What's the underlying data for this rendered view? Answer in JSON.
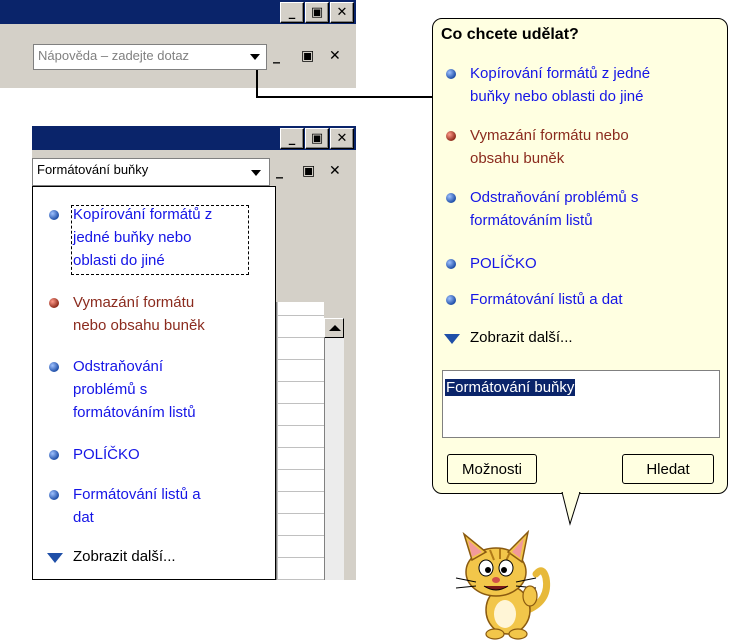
{
  "top_window": {
    "buttons": [
      "_",
      "▣",
      "✕"
    ],
    "help_placeholder": "Nápověda – zadejte dotaz",
    "controls": [
      "_",
      "▣",
      "✕"
    ]
  },
  "inner_window": {
    "buttons": [
      "_",
      "▣",
      "✕"
    ],
    "combo_value": "Formátování buňky",
    "controls": [
      "_",
      "▣",
      "✕"
    ]
  },
  "dropdown": {
    "items": [
      {
        "text": "Kopírování formátů z jedné buňky nebo oblasti do jiné",
        "lines": [
          "Kopírování formátů z",
          "jedné buňky nebo",
          "oblasti do jiné"
        ],
        "color": "#1515e6"
      },
      {
        "text": "Vymazání formátu nebo obsahu buněk",
        "lines": [
          "Vymazání formátu",
          "nebo obsahu buněk"
        ],
        "color": "#8b2b1e"
      },
      {
        "text": "Odstraňování problémů s formátováním listů",
        "lines": [
          "Odstraňování",
          "problémů s",
          "formátováním listů"
        ],
        "color": "#1515e6"
      },
      {
        "text": "POLÍČKO",
        "lines": [
          "POLÍČKO"
        ],
        "color": "#1515e6"
      },
      {
        "text": "Formátování listů a dat",
        "lines": [
          "Formátování listů a",
          "dat"
        ],
        "color": "#1515e6"
      }
    ],
    "more": "Zobrazit další..."
  },
  "balloon": {
    "title": "Co chcete udělat?",
    "items": [
      {
        "lines": [
          "Kopírování formátů z jedné",
          "buňky nebo oblasti do jiné"
        ],
        "color": "#1515e6"
      },
      {
        "lines": [
          "Vymazání formátu nebo",
          "obsahu buněk"
        ],
        "color": "#8b2b1e"
      },
      {
        "lines": [
          "Odstraňování problémů s",
          "formátováním listů"
        ],
        "color": "#1515e6"
      },
      {
        "lines": [
          "POLÍČKO"
        ],
        "color": "#1515e6"
      },
      {
        "lines": [
          "Formátování listů a dat"
        ],
        "color": "#1515e6"
      }
    ],
    "more": "Zobrazit další...",
    "input_value": "Formátování buňky",
    "options_button": "Možnosti",
    "search_button": "Hledat"
  }
}
